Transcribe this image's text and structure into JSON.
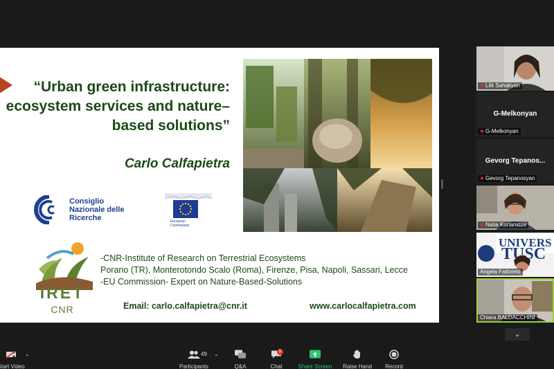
{
  "slide": {
    "title_line1": "“Urban green infrastructure:",
    "title_line2": "ecosystem services and nature–",
    "title_line3": "based solutions”",
    "author": "Carlo Calfapietra",
    "cnr_line1": "Consiglio",
    "cnr_line2": "Nazionale delle",
    "cnr_line3": "Ricerche",
    "eu_caption1": "European",
    "eu_caption2": "Commission",
    "iret_word": "IRET",
    "iret_sub": "CNR",
    "inst_line1": "-CNR-Institute of Research on Terrestrial Ecosystems",
    "inst_line2": " Porano (TR), Monterotondo Scalo (Roma), Firenze, Pisa, Napoli, Sassari, Lecce",
    "inst_line3": "-EU Commission- Expert on Nature-Based-Solutions",
    "email": "Email: carlo.calfapietra@cnr.it",
    "website": "www.carlocalfapietra.com"
  },
  "participants": [
    {
      "name": "Lilit Sahakyan",
      "video": true
    },
    {
      "name": "G-Melkonyan",
      "big_name": "G-Melkonyan",
      "video": false
    },
    {
      "name": "Gevorg Tepanosyan",
      "big_name": "Gevorg Tepanos...",
      "video": false
    },
    {
      "name": "Natia Kurtanidze",
      "video": true
    },
    {
      "name": "Angela Fattoretti",
      "video": true
    },
    {
      "name": "Chiara BALDACCHINI",
      "video": true,
      "active": true
    }
  ],
  "toolbar": {
    "start_video": "Start Video",
    "participants_label": "Participants",
    "participants_count": "49",
    "qa_label": "Q&A",
    "chat_label": "Chat",
    "chat_badge": "5",
    "share_label": "Share Screen",
    "raise_label": "Raise Hand",
    "record_label": "Record"
  },
  "pager_icon": "chevron-down-icon",
  "colors": {
    "slide_green": "#1b4a16",
    "share_green": "#28c76f",
    "active_outline": "#9ccf3a",
    "mute_red": "#e0362b"
  }
}
